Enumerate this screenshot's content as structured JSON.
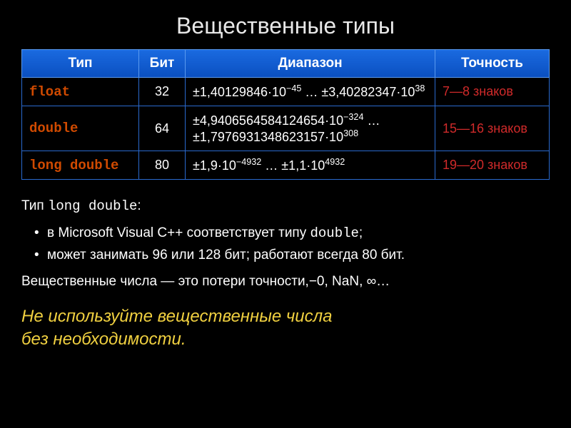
{
  "slide": {
    "title": "Вещественные типы",
    "table": {
      "headers": [
        "Тип",
        "Бит",
        "Диапазон",
        "Точность"
      ],
      "rows": [
        {
          "type": "float",
          "bits": "32",
          "range_html": "±1,40129846·10<sup>−45</sup> … ±3,40282347·10<sup>38</sup>",
          "precision": "7—8 знаков"
        },
        {
          "type": "double",
          "bits": "64",
          "range_html": "±4,9406564584124654·10<sup>−324</sup> … ±1,7976931348623157·10<sup>308</sup>",
          "precision": "15—16 знаков"
        },
        {
          "type": "long double",
          "bits": "80",
          "range_html": "±1,9·10<sup>−4932</sup> … ±1,1·10<sup>4932</sup>",
          "precision": "19—20 знаков"
        }
      ]
    },
    "subtitle_prefix": "Тип ",
    "subtitle_type": "long double",
    "subtitle_suffix": ":",
    "bullets": [
      {
        "prefix": "в Microsoft Visual C++ соответствует типу ",
        "mono": "double",
        "suffix": ";"
      },
      {
        "text": "может занимать 96 или 128 бит; работают всегда 80 бит."
      }
    ],
    "note": "Вещественные числа — это потери точности,−0, NaN, ∞…",
    "highlight_l1": "Не используйте вещественные числа",
    "highlight_l2": "без необходимости."
  },
  "chart_data": {
    "type": "table",
    "title": "Вещественные типы",
    "columns": [
      "Тип",
      "Бит",
      "Диапазон",
      "Точность"
    ],
    "rows": [
      [
        "float",
        32,
        "±1,40129846·10^−45 … ±3,40282347·10^38",
        "7—8 знаков"
      ],
      [
        "double",
        64,
        "±4,9406564584124654·10^−324 … ±1,7976931348623157·10^308",
        "15—16 знаков"
      ],
      [
        "long double",
        80,
        "±1,9·10^−4932 … ±1,1·10^4932",
        "19—20 знаков"
      ]
    ]
  }
}
